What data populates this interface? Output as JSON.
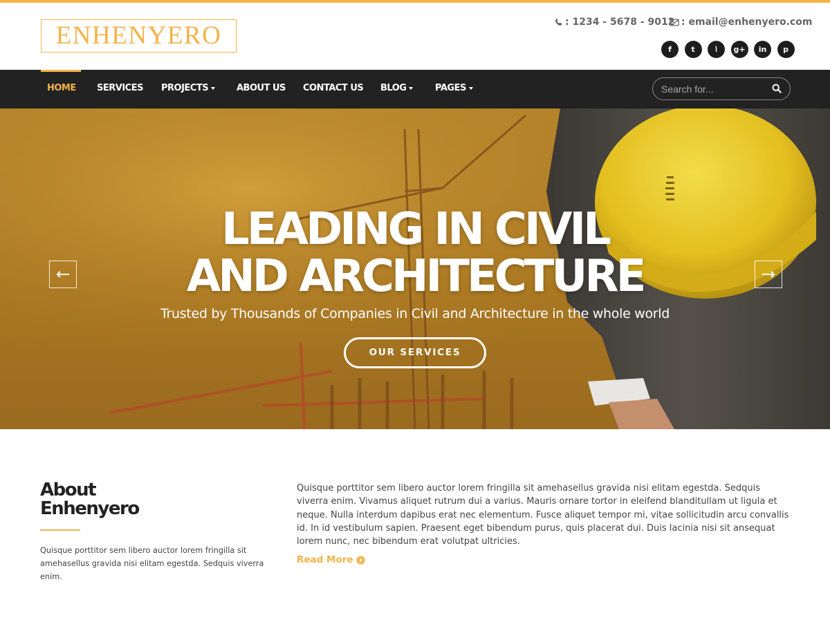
{
  "brand": {
    "logo_text": "ENHENYERO",
    "accent_color": "#f4b347"
  },
  "contact": {
    "phone": ": 1234 - 5678 - 9012",
    "email": ": email@enhenyero.com",
    "phone_icon": "phone-icon",
    "email_icon": "envelope-icon"
  },
  "social": [
    {
      "name": "facebook",
      "glyph": "f"
    },
    {
      "name": "twitter",
      "glyph": "t"
    },
    {
      "name": "rss",
      "glyph": "⌇"
    },
    {
      "name": "google-plus",
      "glyph": "g+"
    },
    {
      "name": "linkedin",
      "glyph": "in"
    },
    {
      "name": "pinterest",
      "glyph": "p"
    }
  ],
  "nav": {
    "items": [
      {
        "label": "HOME",
        "active": true,
        "dropdown": false
      },
      {
        "label": "SERVICES",
        "active": false,
        "dropdown": false
      },
      {
        "label": "PROJECTS",
        "active": false,
        "dropdown": true
      },
      {
        "label": "ABOUT US",
        "active": false,
        "dropdown": false
      },
      {
        "label": "CONTACT US",
        "active": false,
        "dropdown": false
      },
      {
        "label": "BLOG",
        "active": false,
        "dropdown": true
      },
      {
        "label": "PAGES",
        "active": false,
        "dropdown": true
      }
    ],
    "search_placeholder": "Search for..."
  },
  "hero": {
    "title_line1": "LEADING IN CIVIL",
    "title_line2": "AND ARCHITECTURE",
    "subtitle": "Trusted by Thousands of Companies in Civil and Architecture in the whole world",
    "button_label": "OUR SERVICES"
  },
  "about": {
    "title_line1": "About",
    "title_line2": "Enhenyero",
    "short_text": "Quisque porttitor sem libero auctor lorem fringilla sit amehasellus gravida nisi elitam egestda. Sedquis viverra enim.",
    "long_text": "Quisque porttitor sem libero auctor lorem fringilla sit amehasellus gravida nisi elitam egestda. Sedquis viverra enim. Vivamus aliquet rutrum dui a varius. Mauris ornare tortor in eleifend blanditullam ut ligula et neque. Nulla interdum dapibus erat nec elementum. Fusce aliquet tempor mi, vitae sollicitudin arcu convallis id. In id vestibulum sapien. Praesent eget bibendum purus, quis placerat dui. Duis lacinia nisi sit ansequat lorem nunc, nec bibendum erat volutpat ultricies.",
    "read_more": "Read More"
  }
}
